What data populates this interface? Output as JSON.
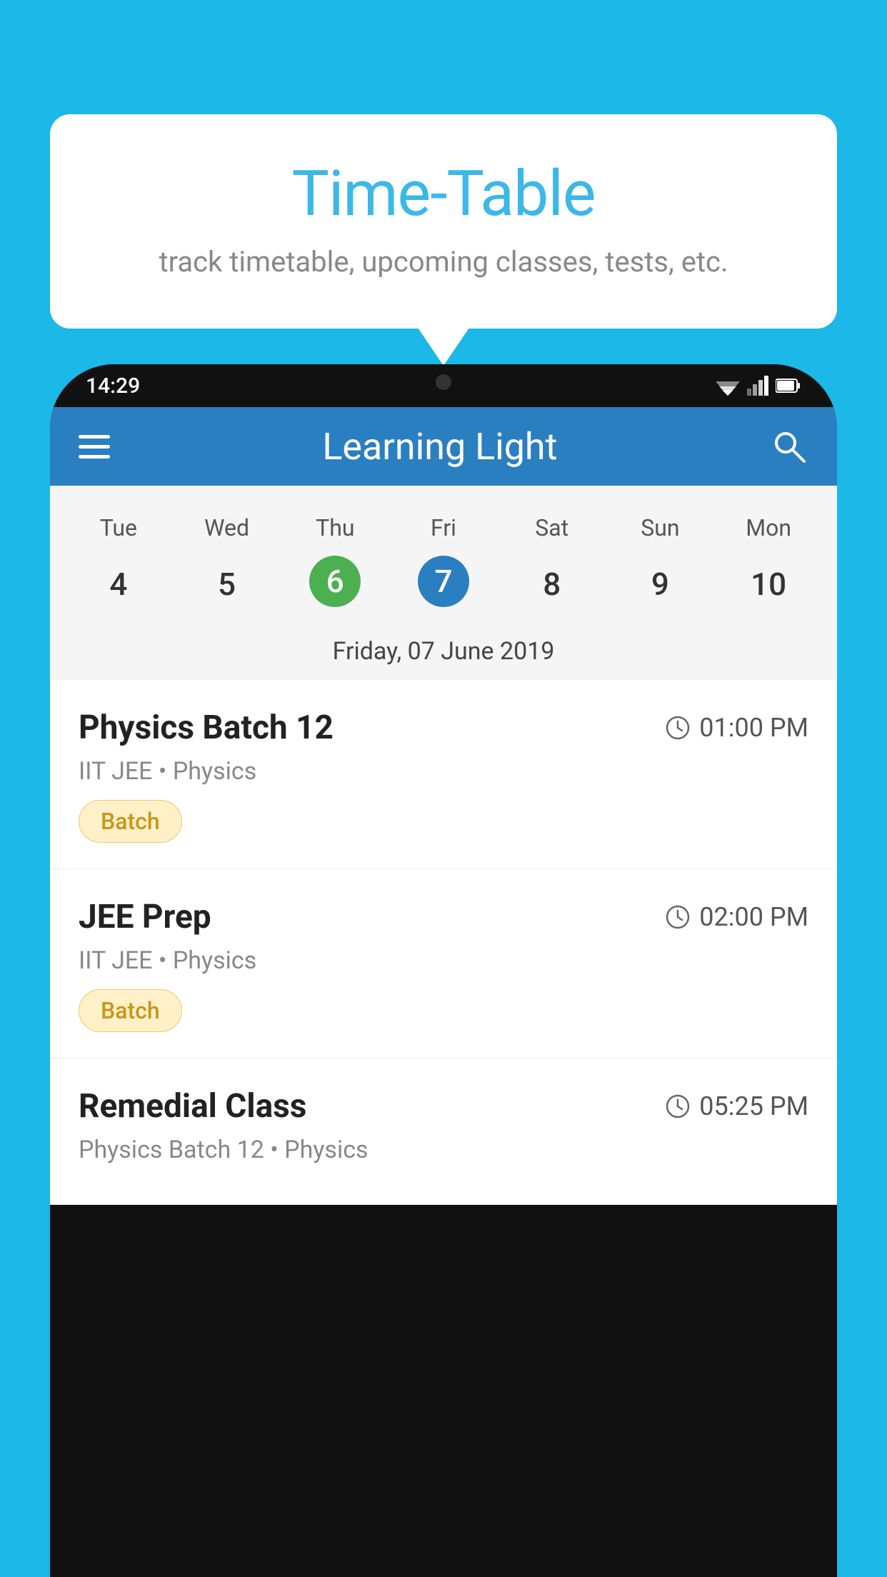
{
  "background_color": "#1BB8E8",
  "tooltip": {
    "title": "Time-Table",
    "subtitle": "track timetable, upcoming classes, tests, etc."
  },
  "phone": {
    "status_bar": {
      "time": "14:29"
    },
    "app_header": {
      "title": "Learning Light"
    },
    "calendar": {
      "days_of_week": [
        "Tue",
        "Wed",
        "Thu",
        "Fri",
        "Sat",
        "Sun",
        "Mon"
      ],
      "dates": [
        "4",
        "5",
        "6",
        "7",
        "8",
        "9",
        "10"
      ],
      "today_index": 2,
      "selected_index": 3,
      "selected_date_label": "Friday, 07 June 2019"
    },
    "classes": [
      {
        "name": "Physics Batch 12",
        "time": "01:00 PM",
        "meta": "IIT JEE • Physics",
        "badge": "Batch"
      },
      {
        "name": "JEE Prep",
        "time": "02:00 PM",
        "meta": "IIT JEE • Physics",
        "badge": "Batch"
      },
      {
        "name": "Remedial Class",
        "time": "05:25 PM",
        "meta": "Physics Batch 12 • Physics",
        "badge": null
      }
    ]
  },
  "icons": {
    "hamburger": "☰",
    "search": "🔍",
    "clock": "🕐"
  }
}
